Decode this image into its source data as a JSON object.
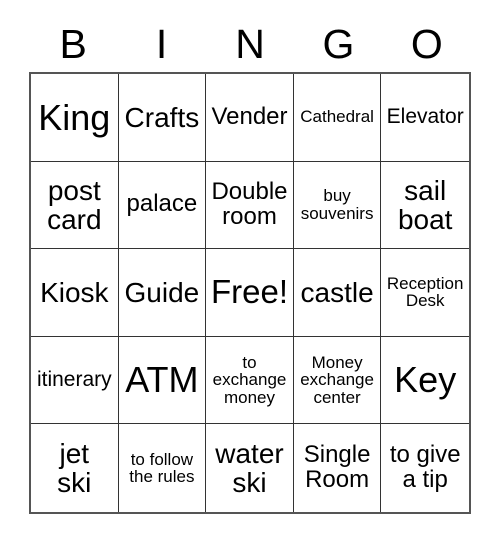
{
  "card": {
    "header_letters": [
      "B",
      "I",
      "N",
      "G",
      "O"
    ],
    "free_space_label": "Free!",
    "grid_line_color": "#333333",
    "border_color": "#555555",
    "background_color": "#ffffff",
    "text_color": "#000000",
    "rows": 5,
    "columns": 5
  },
  "cells": [
    {
      "text": "King",
      "size": "fs-xl"
    },
    {
      "text": "Crafts",
      "size": "fs-md"
    },
    {
      "text": "Vender",
      "size": "fs-sm"
    },
    {
      "text": "Cathedral",
      "size": "fs-xxs"
    },
    {
      "text": "Elevator",
      "size": "fs-xs"
    },
    {
      "text": "post\ncard",
      "size": "fs-md"
    },
    {
      "text": "palace",
      "size": "fs-sm"
    },
    {
      "text": "Double\nroom",
      "size": "fs-sm"
    },
    {
      "text": "buy\nsouvenirs",
      "size": "fs-xxs"
    },
    {
      "text": "sail\nboat",
      "size": "fs-md"
    },
    {
      "text": "Kiosk",
      "size": "fs-md"
    },
    {
      "text": "Guide",
      "size": "fs-md"
    },
    {
      "text": "Free!",
      "size": "fs-lg"
    },
    {
      "text": "castle",
      "size": "fs-md"
    },
    {
      "text": "Reception\nDesk",
      "size": "fs-xxs"
    },
    {
      "text": "itinerary",
      "size": "fs-xs"
    },
    {
      "text": "ATM",
      "size": "fs-xl"
    },
    {
      "text": "to\nexchange\nmoney",
      "size": "fs-xxs"
    },
    {
      "text": "Money\nexchange\ncenter",
      "size": "fs-xxs"
    },
    {
      "text": "Key",
      "size": "fs-xl"
    },
    {
      "text": "jet\nski",
      "size": "fs-md"
    },
    {
      "text": "to follow\nthe rules",
      "size": "fs-xxs"
    },
    {
      "text": "water\nski",
      "size": "fs-md"
    },
    {
      "text": "Single\nRoom",
      "size": "fs-sm"
    },
    {
      "text": "to give\na tip",
      "size": "fs-sm"
    }
  ]
}
